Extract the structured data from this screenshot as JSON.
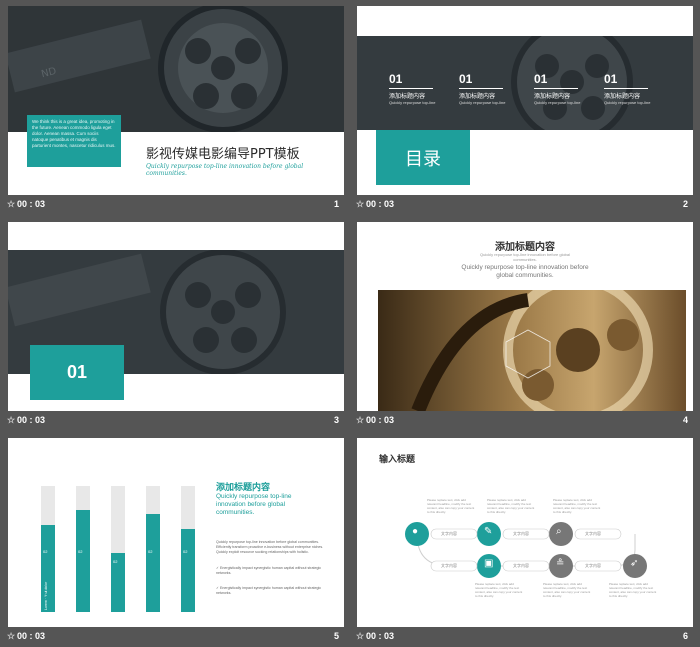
{
  "slides": [
    {
      "index": "1",
      "time": "00 : 03",
      "title": "影视传媒电影编导PPT模板",
      "subtitle": "Quickly repurpose top-line innovation before global communities.",
      "box_text": "We think this is a great idea, promoting in the future. Aenean commodo ligula eget dolor. Aenean massa. Cum sociis natoque penatibus et magnis dis parturient montes, nascetur ridiculus mus."
    },
    {
      "index": "2",
      "time": "00 : 03",
      "toc_label": "目录",
      "items": [
        {
          "num": "01",
          "title": "添加标题内容",
          "sub": "Quickly repurpose top-line"
        },
        {
          "num": "01",
          "title": "添加标题内容",
          "sub": "Quickly repurpose top-line"
        },
        {
          "num": "01",
          "title": "添加标题内容",
          "sub": "Quickly repurpose top-line"
        },
        {
          "num": "01",
          "title": "添加标题内容",
          "sub": "Quickly repurpose top-line"
        }
      ]
    },
    {
      "index": "3",
      "time": "00 : 03",
      "section_num": "01"
    },
    {
      "index": "4",
      "time": "00 : 03",
      "title": "添加标题内容",
      "small": "Quickly repurpose top-line innovation before global communities.",
      "sub": "Quickly repurpose top-line innovation before global communities."
    },
    {
      "index": "5",
      "time": "00 : 03",
      "title": "添加标题内容",
      "sub": "Quickly repurpose top-line innovation before global communities.",
      "para": "Quickly repurpose top-line innovation before global communities. Efficiently transform proactive e-business without enterprise niches. Quickly exploit resource sucking relationships with holistic.",
      "bullets": [
        "Energistically impact synergistic human capital without strategic networks.",
        "Energistically impact synergistic human capital without strategic networks."
      ],
      "bars": [
        {
          "fill": 0.69,
          "label": "02"
        },
        {
          "fill": 0.81,
          "label": "02"
        },
        {
          "fill": 0.47,
          "label": "02"
        },
        {
          "fill": 0.78,
          "label": "02"
        },
        {
          "fill": 0.66,
          "label": "02"
        }
      ],
      "bar_text": "Lorem · Y·ut dolor"
    },
    {
      "index": "6",
      "time": "00 : 03",
      "title": "输入标题",
      "pills": [
        "文字内容",
        "文字内容",
        "文字内容",
        "文字内容",
        "文字内容",
        "文字内容"
      ],
      "note": "Please replace text, click add relevant headline, modify the text content, also can copy your content to this directly."
    }
  ],
  "icons": [
    "user-icon",
    "pencil-icon",
    "search-icon",
    "briefcase-icon",
    "broadcast-icon",
    "rocket-icon"
  ],
  "colors": {
    "teal": "#1e9f9b",
    "frame": "#555555",
    "photo_dark": "#2d3539"
  }
}
